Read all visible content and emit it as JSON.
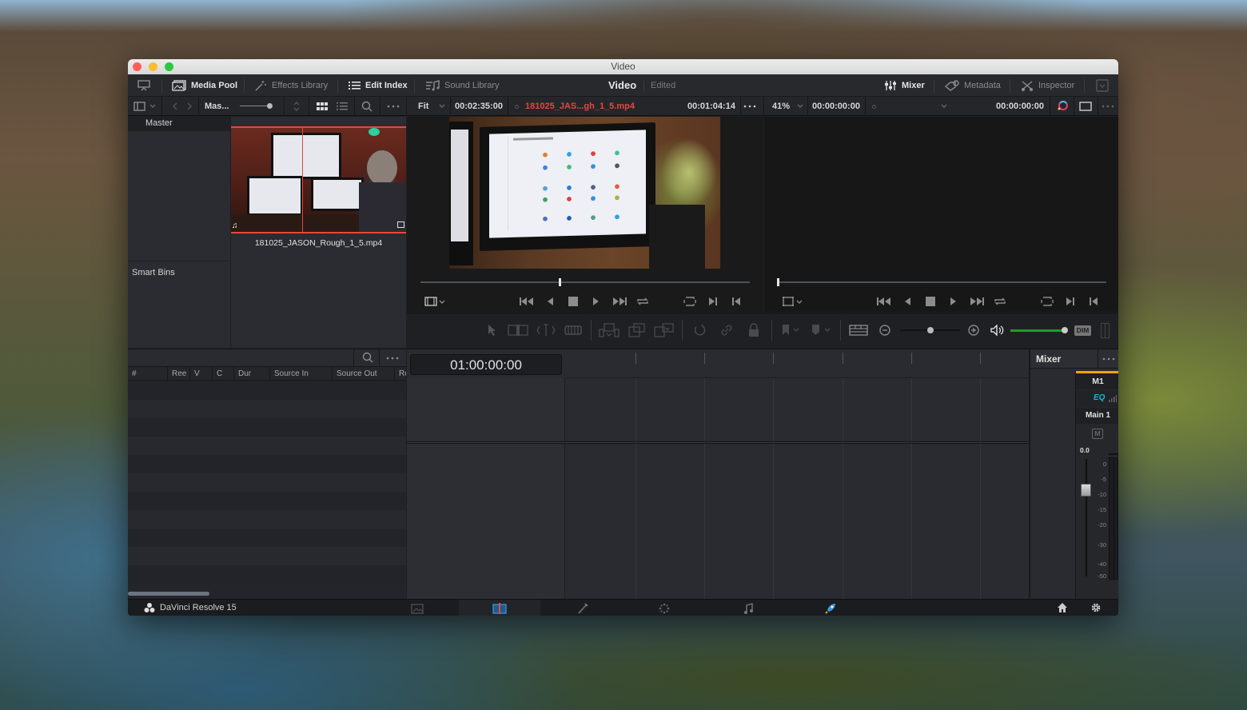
{
  "window": {
    "title": "Video"
  },
  "toolbar": {
    "media_pool": "Media Pool",
    "effects_library": "Effects Library",
    "edit_index": "Edit Index",
    "sound_library": "Sound Library",
    "center_title": "Video",
    "center_status": "Edited",
    "mixer": "Mixer",
    "metadata": "Metadata",
    "inspector": "Inspector"
  },
  "subbar": {
    "bin_name": "Mas...",
    "zoom_fit": "Fit",
    "source_duration": "00:02:35:00",
    "clip_name": "181025_JAS...gh_1_5.mp4",
    "source_timecode": "00:01:04:14",
    "timeline_zoom": "41%",
    "timeline_duration": "00:00:00:00",
    "record_timecode": "00:00:00:00"
  },
  "bins": {
    "master": "Master",
    "smart_bins": "Smart Bins"
  },
  "media_pool": {
    "clips": [
      {
        "name": "181025_JASON_Rough_1_5.mp4"
      }
    ]
  },
  "edit_index": {
    "columns": [
      "#",
      "Ree",
      "V",
      "C",
      "Dur",
      "Source In",
      "Source Out",
      "Re"
    ],
    "rows": []
  },
  "source_viewer": {
    "playhead_fraction": 0.42
  },
  "record_viewer": {
    "playhead_fraction": 0.0
  },
  "timeline": {
    "timecode": "01:00:00:00"
  },
  "edit_tools": {
    "zoom_level": 0.5,
    "volume_level": 1.0,
    "dim_label": "DIM"
  },
  "mixer": {
    "title": "Mixer",
    "channel": "M1",
    "eq_label": "EQ",
    "bus": "Main 1",
    "mute_label": "M",
    "fader_value": "0.0",
    "meter_scale": [
      "0",
      "-5",
      "-10",
      "-15",
      "-20",
      "-30",
      "-40",
      "-50"
    ]
  },
  "footer": {
    "app_name": "DaVinci Resolve 15",
    "pages": [
      "media",
      "edit",
      "fusion",
      "color",
      "fairlight",
      "deliver"
    ],
    "active_page": "edit"
  },
  "colors": {
    "accent_red": "#e4483c",
    "mixer_orange": "#f0a500",
    "eq_cyan": "#1bb6d8",
    "volume_green": "#16a31f",
    "deliver_blue": "#3a9be0"
  }
}
